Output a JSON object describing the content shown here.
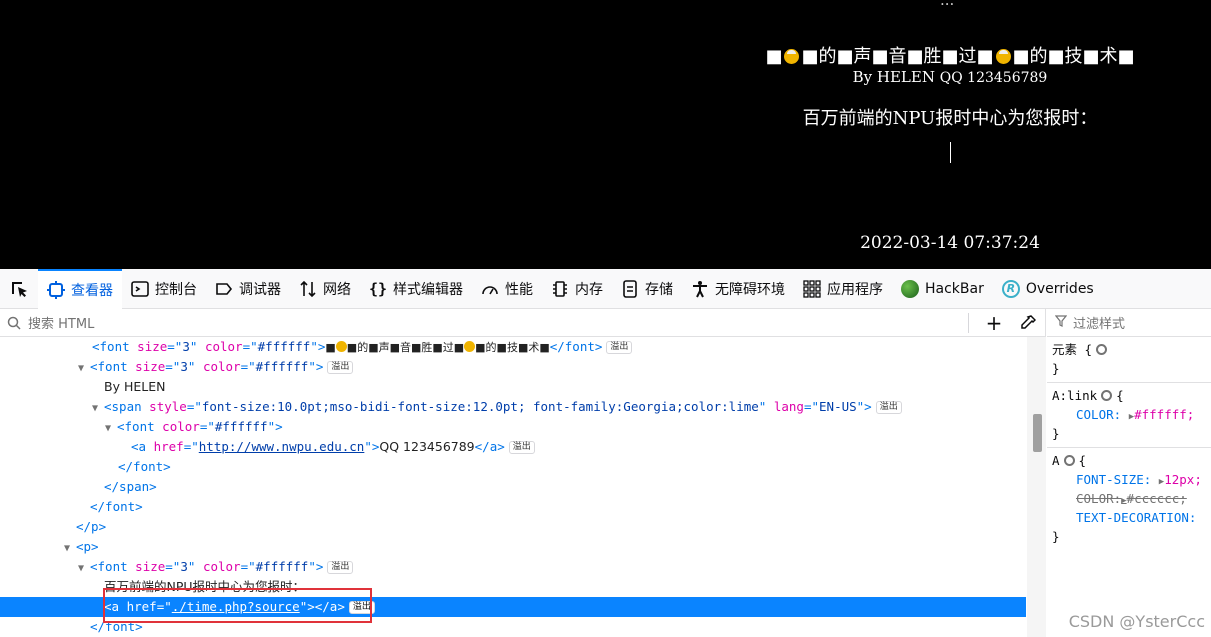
{
  "page": {
    "top_clip": "...",
    "song": [
      "■",
      "face",
      "■的■声■音■胜■过■",
      "face",
      "■的■技■术■"
    ],
    "by_text": "By  HELEN",
    "qq_text": "QQ 123456789",
    "report_text": "百万前端的NPU报时中心为您报时：",
    "time_text": "2022-03-14 07:37:24"
  },
  "toolbar": {
    "tabs": [
      {
        "label": "查看器",
        "icon": "inspector-icon"
      },
      {
        "label": "控制台",
        "icon": "console-icon"
      },
      {
        "label": "调试器",
        "icon": "debugger-icon"
      },
      {
        "label": "网络",
        "icon": "network-icon"
      },
      {
        "label": "样式编辑器",
        "icon": "style-editor-icon"
      },
      {
        "label": "性能",
        "icon": "performance-icon"
      },
      {
        "label": "内存",
        "icon": "memory-icon"
      },
      {
        "label": "存储",
        "icon": "storage-icon"
      },
      {
        "label": "无障碍环境",
        "icon": "accessibility-icon"
      },
      {
        "label": "应用程序",
        "icon": "application-icon"
      },
      {
        "label": "HackBar",
        "icon": "hackbar-icon"
      },
      {
        "label": "Overrides",
        "icon": "overrides-icon"
      }
    ]
  },
  "markup": {
    "search_placeholder": "搜索 HTML",
    "badge_label": "溢出",
    "font_song_text": "■■的■声■音■胜■过■■的■技■术■",
    "by_helen": "By HELEN",
    "span_style": "font-size:10.0pt;mso-bidi-font-size:12.0pt; font-family:Georgia;color:lime",
    "span_lang": "EN-US",
    "link_href": "http://www.nwpu.edu.cn",
    "link_text": "QQ 123456789",
    "report_text": "百万前端的NPU报时中心为您报时：",
    "time_href": "./time.php?source",
    "attr_size": "3",
    "attr_color": "#ffffff"
  },
  "rules": {
    "filter_placeholder": "过滤样式",
    "element_selector": "元素",
    "alink_selector": "A:link",
    "alink_prop": "COLOR:",
    "alink_value": "#ffffff;",
    "a_selector": "A",
    "a_props": [
      {
        "name": "FONT-SIZE:",
        "value": "12px;"
      },
      {
        "name": "COLOR:",
        "value": "#cccccc;"
      },
      {
        "name": "TEXT-DECORATION:",
        "value": ""
      }
    ]
  },
  "watermark": "CSDN @YsterCcc"
}
